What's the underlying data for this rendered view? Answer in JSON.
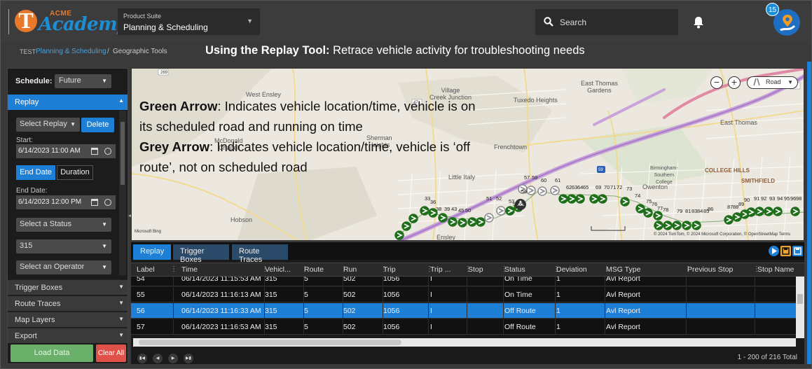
{
  "header": {
    "logo_top": "ACME",
    "logo_main": "Academy",
    "logo_letter": "T",
    "suite_label": "Product Suite",
    "suite_value": "Planning & Scheduling",
    "search_label": "Search",
    "notification_count": "15"
  },
  "breadcrumb": {
    "env": "TEST",
    "suite": "Planning & Scheduling",
    "separator": "/",
    "page": "Geographic Tools"
  },
  "headline": {
    "bold": "Using the Replay Tool:",
    "rest": " Retrace vehicle activity for troubleshooting needs"
  },
  "left_panel": {
    "schedule_label": "Schedule:",
    "schedule_value": "Future",
    "replay_header": "Replay",
    "select_replay": "Select Replay",
    "delete_label": "Delete",
    "start_label": "Start:",
    "start_value": "6/14/2023 11:00 AM",
    "tab_end_date": "End Date",
    "tab_duration": "Duration",
    "end_label": "End Date:",
    "end_value": "6/14/2023 12:00 PM",
    "status_placeholder": "Select a Status",
    "route_value": "315",
    "operator_placeholder": "Select an Operator",
    "sections": [
      "Trigger Boxes",
      "Route Traces",
      "Map Layers",
      "Export"
    ],
    "load_label": "Load Data",
    "clear_label": "Clear All"
  },
  "map": {
    "annotation": {
      "green_bold": "Green Arrow",
      "green_text": ": Indicates vehicle location/time, vehicle is on its scheduled road and running on time",
      "grey_bold": "Grey Arrow",
      "grey_text": ": Indicates vehicle location/time, vehicle is ‘off route’, not on scheduled road"
    },
    "map_type": "Road",
    "labels": {
      "west_ensley": "West Ensley",
      "village_creek": "Village\nCreek Junction",
      "tuxedo": "Tuxedo Heights",
      "east_thomas_gardens": "East Thomas\nGardens",
      "east_thomas": "East Thomas",
      "mcdonald": "McDonald\nChapel",
      "sherman": "Sherman\nHeights",
      "frenchtown": "Frenchtown",
      "little_italy": "Little Italy",
      "birmingham": "Birmingham-\nSouthern\nCollege",
      "college_hills": "COLLEGE HILLS",
      "owenton": "Owenton",
      "smithfield": "SMITHFIELD",
      "hobson": "Hobson",
      "ensley": "Ensley"
    },
    "attribution": "© 2024 TomTom, © 2024 Microsoft Corporation, © OpenStreetMap  Terms",
    "ms_logo": "Microsoft Bing",
    "stop_numbers": [
      "33",
      "36",
      "38",
      "39",
      "43",
      "45",
      "50",
      "51",
      "52",
      "53",
      "54",
      "55",
      "56",
      "57",
      "59",
      "60",
      "61",
      "62",
      "63",
      "64",
      "65",
      "69",
      "70",
      "71",
      "72",
      "73",
      "74",
      "75",
      "76",
      "77",
      "78",
      "79",
      "81",
      "83",
      "84",
      "85",
      "86",
      "87",
      "88",
      "89",
      "90",
      "91",
      "92",
      "93",
      "94",
      "95",
      "96",
      "98"
    ]
  },
  "grid": {
    "tabs": [
      "Replay",
      "Trigger Boxes",
      "Route Traces"
    ],
    "columns": [
      "Label",
      "Time",
      "Vehicl...",
      "Route",
      "Run",
      "Trip",
      "Trip ...",
      "Stop",
      "Status",
      "Deviation",
      "MSG Type",
      "Previous Stop",
      "Stop Name"
    ],
    "rows": [
      [
        "54",
        "06/14/2023 11:15:53 AM",
        "315",
        "5",
        "502",
        "1056",
        "I",
        "",
        "On Time",
        "1",
        "Avl Report",
        "",
        ""
      ],
      [
        "55",
        "06/14/2023 11:16:13 AM",
        "315",
        "5",
        "502",
        "1056",
        "I",
        "",
        "On Time",
        "1",
        "Avl Report",
        "",
        ""
      ],
      [
        "56",
        "06/14/2023 11:16:33 AM",
        "315",
        "5",
        "502",
        "1056",
        "I",
        "",
        "Off Route",
        "1",
        "Avl Report",
        "",
        ""
      ],
      [
        "57",
        "06/14/2023 11:16:53 AM",
        "315",
        "5",
        "502",
        "1056",
        "I",
        "",
        "Off Route",
        "1",
        "Avl Report",
        "",
        ""
      ]
    ],
    "selected_row": 2,
    "page_count": "1 - 200 of 216 Total"
  },
  "colors": {
    "accent": "#1e7fd6",
    "on_time": "#1f6e1a",
    "off_route": "#8a8a8a",
    "load": "#6ab06a",
    "clear": "#e0514a"
  }
}
